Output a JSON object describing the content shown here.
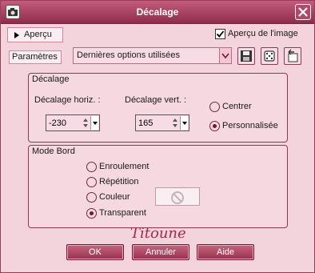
{
  "window": {
    "title": "Décalage"
  },
  "preview": {
    "label": "Aperçu"
  },
  "preview_image": {
    "label": "Aperçu de l'image",
    "checked": true
  },
  "params": {
    "label": "Paramètres",
    "preset_value": "Dernières options utilisées"
  },
  "offset_group": {
    "title": "Décalage",
    "horiz_label": "Décalage horiz. :",
    "horiz_value": "-230",
    "vert_label": "Décalage vert. :",
    "vert_value": "165",
    "option_center": "Centrer",
    "option_custom": "Personnalisée",
    "selected": "Personnalisée"
  },
  "edge_group": {
    "title": "Mode Bord",
    "options": [
      "Enroulement",
      "Répétition",
      "Couleur",
      "Transparent"
    ],
    "selected": "Transparent"
  },
  "signature": "Titoune",
  "buttons": {
    "ok": "OK",
    "cancel": "Annuler",
    "help": "Aide"
  },
  "colors": {
    "accent": "#8f2c4c",
    "panel": "#f3d3dc"
  },
  "icons": {
    "title": "camera-icon",
    "close": "close-icon",
    "save": "save-preset-icon",
    "random": "dice-icon",
    "reset": "reset-icon"
  }
}
